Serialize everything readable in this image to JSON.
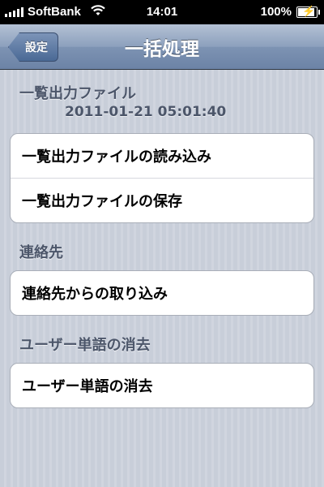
{
  "status_bar": {
    "carrier": "SoftBank",
    "time": "14:01",
    "battery": "100%",
    "battery_level": 1.0
  },
  "nav": {
    "back_label": "設定",
    "title": "一括処理"
  },
  "sections": [
    {
      "header": "一覧出力ファイル",
      "subheader": "2011-01-21 05:01:40",
      "rows": [
        "一覧出力ファイルの読み込み",
        "一覧出力ファイルの保存"
      ]
    },
    {
      "header": "連絡先",
      "rows": [
        "連絡先からの取り込み"
      ]
    },
    {
      "header": "ユーザー単語の消去",
      "rows": [
        "ユーザー単語の消去"
      ]
    }
  ],
  "colors": {
    "nav_bar": "#7d93b3",
    "background": "#c7cdd8",
    "section_header": "#4c566a"
  },
  "icons": [
    "signal-icon",
    "wifi-icon",
    "battery-icon",
    "back-chevron-icon"
  ]
}
